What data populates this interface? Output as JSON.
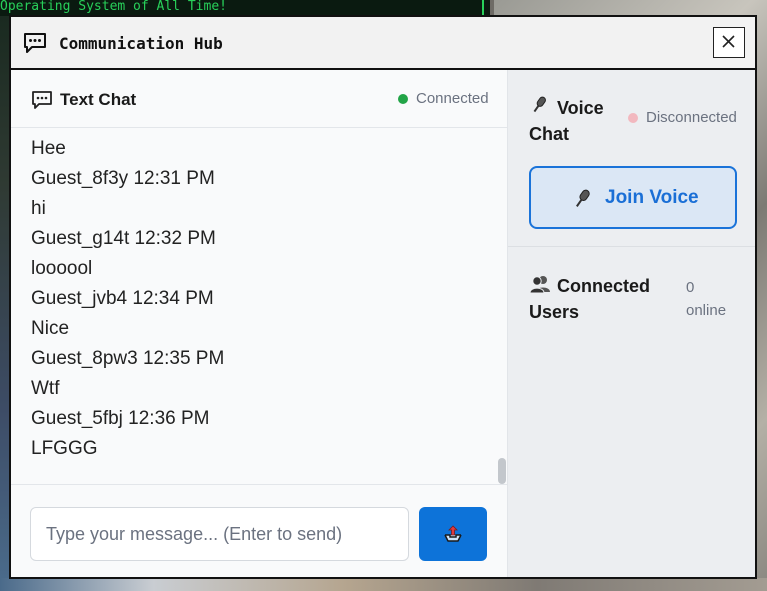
{
  "background": {
    "text_snippet": "Operating System of All Time!"
  },
  "window": {
    "title": "Communication Hub",
    "close_symbol": "×"
  },
  "chat": {
    "title": "Text Chat",
    "status": "Connected",
    "messages": [
      "Hee",
      "Guest_8f3y 12:31 PM",
      "hi",
      "Guest_g14t 12:32 PM",
      "loooool",
      "Guest_jvb4 12:34 PM",
      "Nice",
      "Guest_8pw3 12:35 PM",
      "Wtf",
      "Guest_5fbj 12:36 PM",
      "LFGGG"
    ],
    "input_placeholder": "Type your message... (Enter to send)"
  },
  "voice": {
    "title": "Voice Chat",
    "status": "Disconnected",
    "join_label": "Join Voice"
  },
  "users": {
    "title": "Connected Users",
    "count": "0",
    "count_suffix": "online"
  },
  "colors": {
    "connected": "#22a447",
    "disconnected": "#f2b8bf",
    "accent": "#0d73d9"
  }
}
